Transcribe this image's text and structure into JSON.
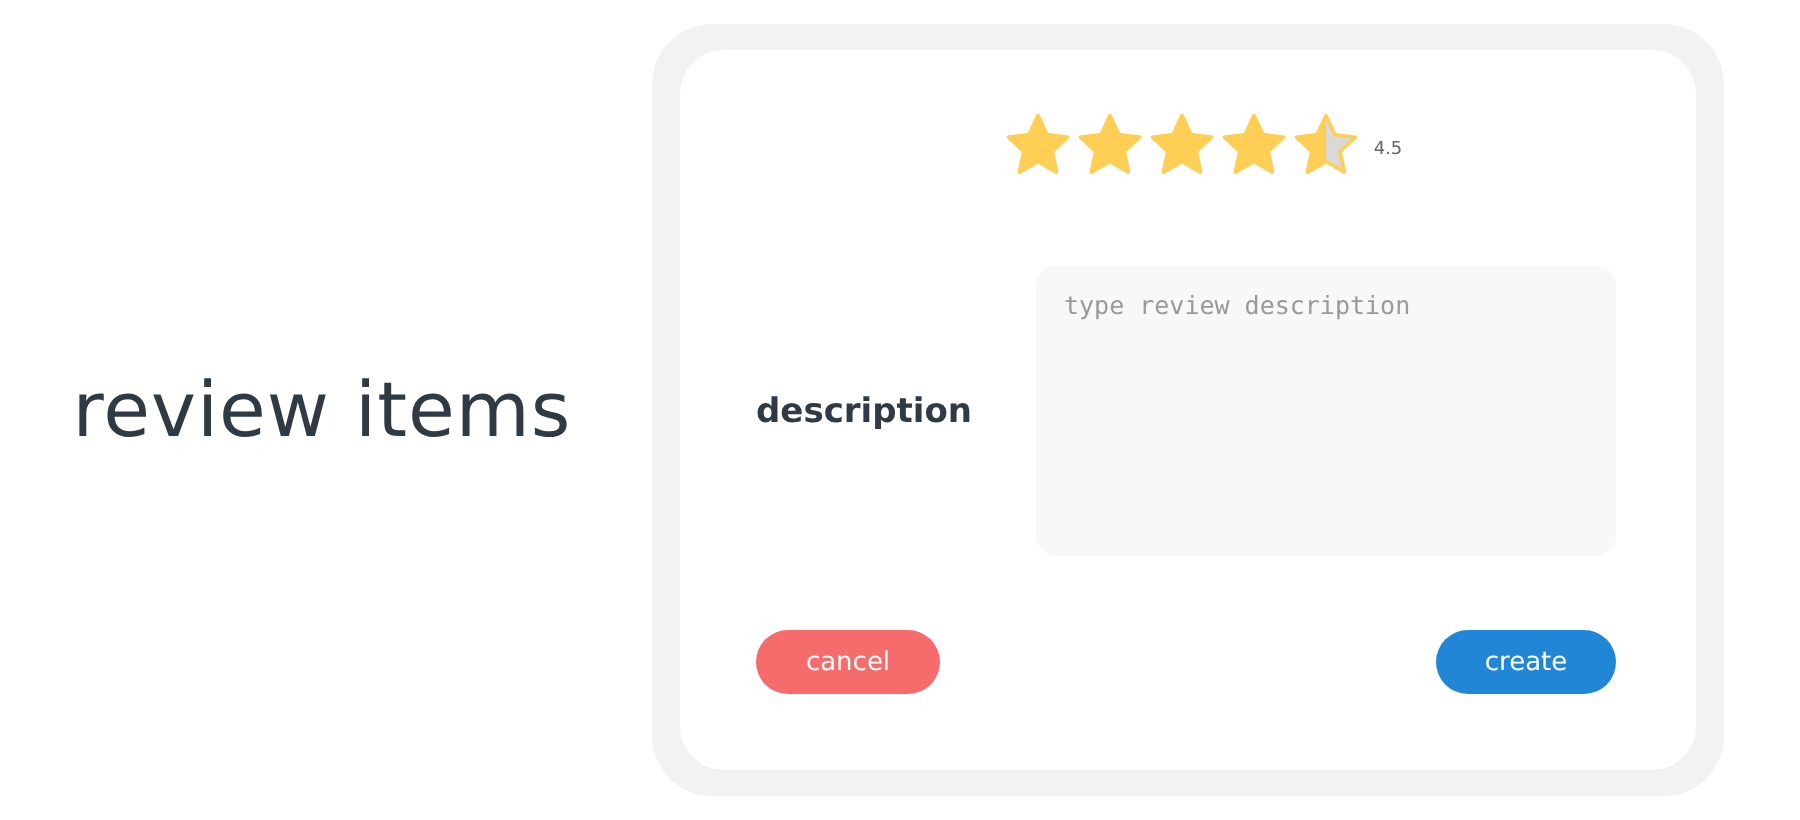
{
  "heading": "review items",
  "rating": {
    "stars": 4.5,
    "reading": "4.5"
  },
  "description": {
    "label": "description",
    "placeholder": "type review description"
  },
  "buttons": [
    {
      "kind": "cancel",
      "label": "cancel"
    },
    {
      "kind": "create",
      "label": "create"
    }
  ]
}
